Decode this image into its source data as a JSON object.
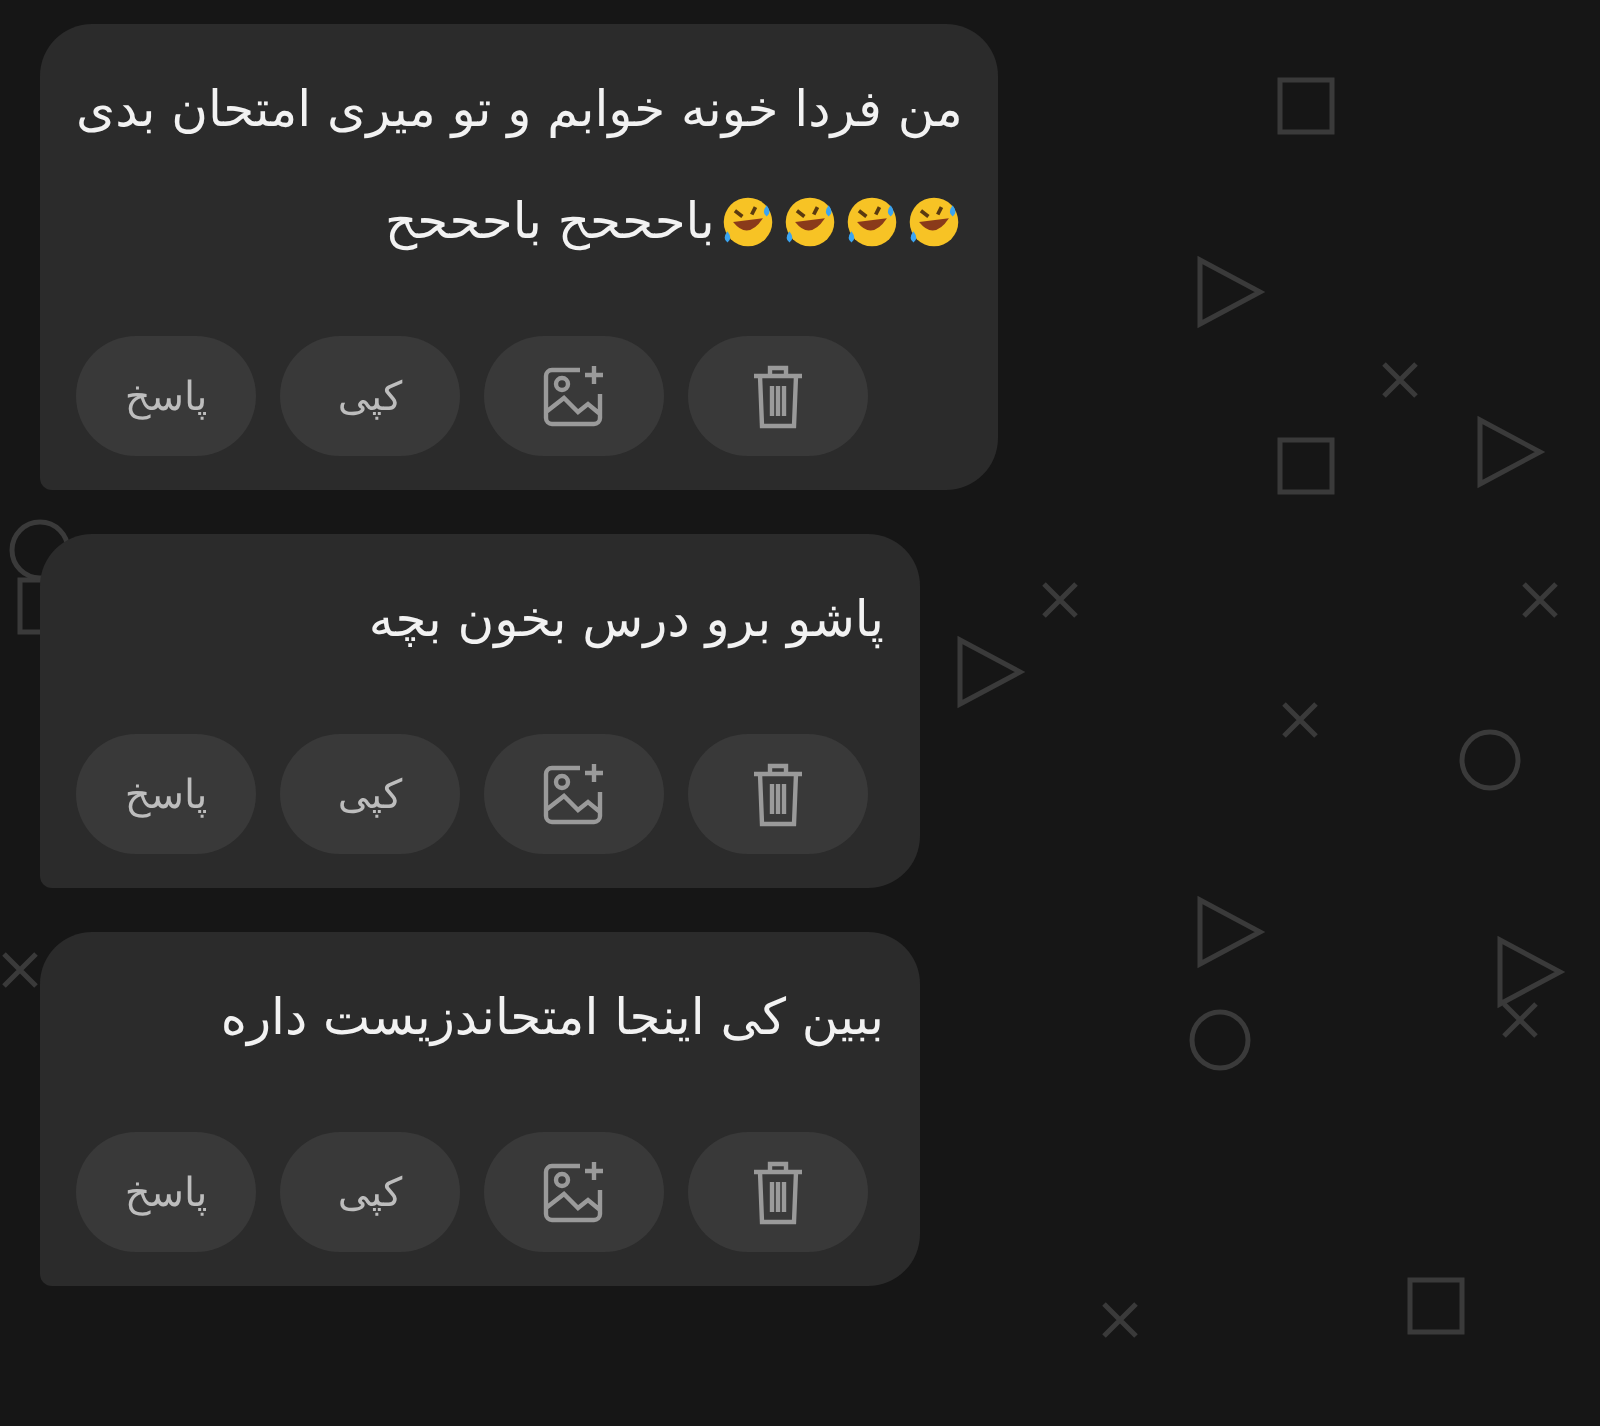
{
  "messages": [
    {
      "lines": [
        {
          "text": "من فردا خونه خوابم و تو میری امتحان بدی"
        },
        {
          "text": "باحححح باحححح",
          "emojis": [
            {
              "kind": "rofl"
            },
            {
              "kind": "rofl"
            },
            {
              "kind": "rofl"
            },
            {
              "kind": "rofl"
            }
          ]
        }
      ],
      "actions": [
        {
          "kind": "delete"
        },
        {
          "kind": "image"
        },
        {
          "kind": "text",
          "label": "کپی"
        },
        {
          "kind": "text",
          "label": "پاسخ"
        }
      ]
    },
    {
      "lines": [
        {
          "text": "پاشو برو درس بخون بچه"
        }
      ],
      "actions": [
        {
          "kind": "delete"
        },
        {
          "kind": "image"
        },
        {
          "kind": "text",
          "label": "کپی"
        },
        {
          "kind": "text",
          "label": "پاسخ"
        }
      ]
    },
    {
      "lines": [
        {
          "text": "ببین کی اینجا امتحاندزیست داره"
        }
      ],
      "actions": [
        {
          "kind": "delete"
        },
        {
          "kind": "image"
        },
        {
          "kind": "text",
          "label": "کپی"
        },
        {
          "kind": "text",
          "label": "پاسخ"
        }
      ]
    }
  ]
}
